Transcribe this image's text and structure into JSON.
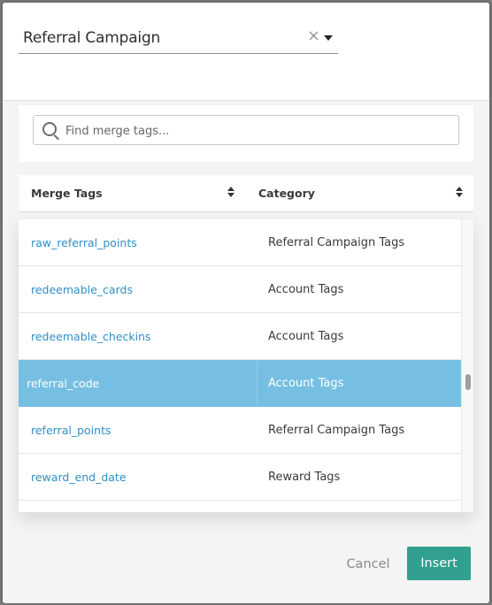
{
  "campaign_select": {
    "value": "Referral Campaign",
    "clear_icon": "×"
  },
  "search": {
    "placeholder": "Find merge tags..."
  },
  "table": {
    "headers": {
      "merge_tags": "Merge Tags",
      "category": "Category"
    },
    "rows": [
      {
        "tag": "raw_referral_points",
        "category": "Referral Campaign Tags",
        "selected": false
      },
      {
        "tag": "redeemable_cards",
        "category": "Account Tags",
        "selected": false
      },
      {
        "tag": "redeemable_checkins",
        "category": "Account Tags",
        "selected": false
      },
      {
        "tag": "referral_code",
        "category": "Account Tags",
        "selected": true
      },
      {
        "tag": "referral_points",
        "category": "Referral Campaign Tags",
        "selected": false
      },
      {
        "tag": "reward_end_date",
        "category": "Reward Tags",
        "selected": false
      }
    ]
  },
  "footer": {
    "cancel_label": "Cancel",
    "insert_label": "Insert"
  },
  "colors": {
    "accent": "#31a08e",
    "link": "#2f8fc7",
    "selected_row": "#76bfe3"
  }
}
